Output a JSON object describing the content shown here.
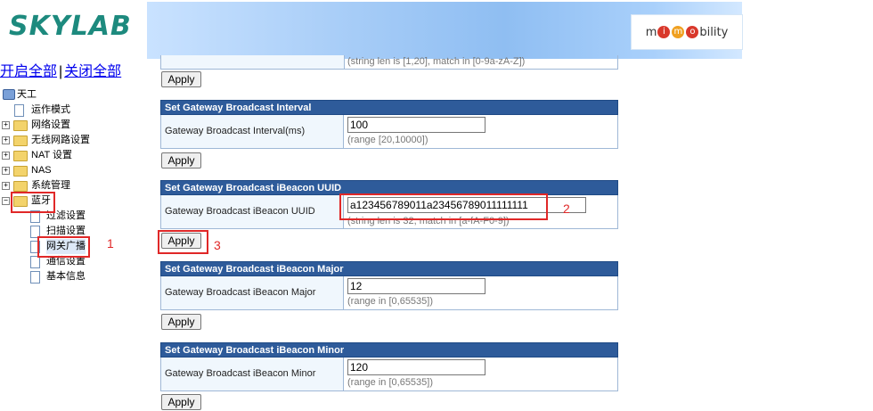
{
  "logo": "SKYLAB",
  "brand_partner": {
    "prefix": "m",
    "letters": [
      "i",
      "m",
      "o"
    ],
    "suffix": "bility"
  },
  "expand": {
    "open_all": "开启全部",
    "separator": "|",
    "close_all": "关闭全部"
  },
  "tree": {
    "root": "天工",
    "items": [
      {
        "label": "运作模式",
        "type": "page"
      },
      {
        "label": "网络设置",
        "type": "folder"
      },
      {
        "label": "无线网路设置",
        "type": "folder"
      },
      {
        "label": "NAT 设置",
        "type": "folder"
      },
      {
        "label": "NAS",
        "type": "folder"
      },
      {
        "label": "系统管理",
        "type": "folder"
      },
      {
        "label": "蓝牙",
        "type": "folder-open"
      }
    ],
    "bluetooth_children": [
      "过滤设置",
      "扫描设置",
      "网关广播",
      "通信设置",
      "基本信息"
    ]
  },
  "annotations": {
    "one": "1",
    "two": "2",
    "three": "3"
  },
  "top_hint": "(string len is [1,20], match in [0-9a-zA-Z])",
  "apply_label": "Apply",
  "sections": {
    "interval": {
      "title": "Set Gateway Broadcast Interval",
      "label": "Gateway Broadcast Interval(ms)",
      "value": "100",
      "hint": "(range [20,10000])"
    },
    "uuid": {
      "title": "Set Gateway Broadcast iBeacon UUID",
      "label": "Gateway Broadcast iBeacon UUID",
      "value": "a123456789011a23456789011111111",
      "hint": "(string len is 32, match in [a-fA-F0-9])"
    },
    "major": {
      "title": "Set Gateway Broadcast iBeacon Major",
      "label": "Gateway Broadcast iBeacon Major",
      "value": "12",
      "hint": "(range in [0,65535])"
    },
    "minor": {
      "title": "Set Gateway Broadcast iBeacon Minor",
      "label": "Gateway Broadcast iBeacon Minor",
      "value": "120",
      "hint": "(range in [0,65535])"
    }
  },
  "colors": {
    "header_bg": "#2e5b9a",
    "label_bg": "#f0f7fd",
    "annotation": "#e02828"
  }
}
